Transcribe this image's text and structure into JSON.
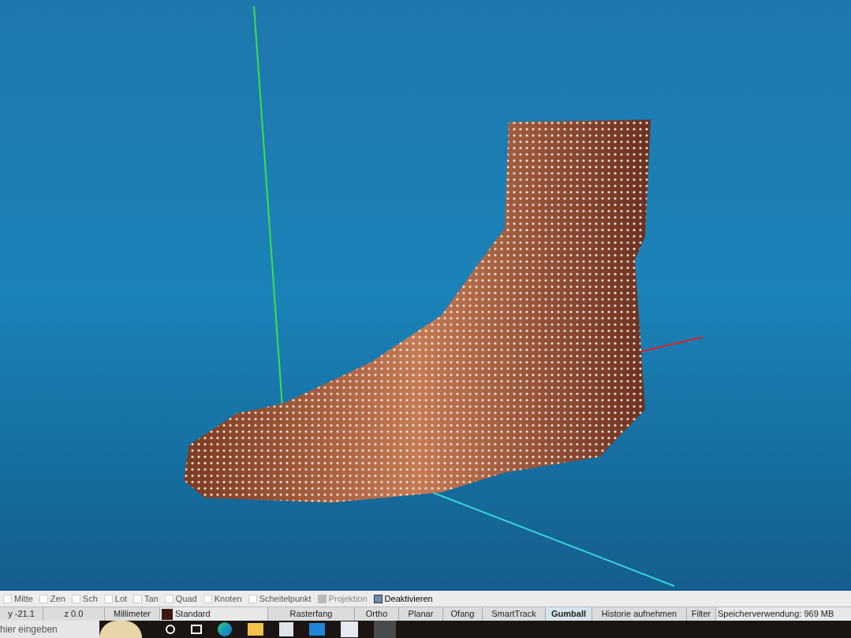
{
  "osnap": [
    {
      "label": "Mitte",
      "checked": false,
      "disabled": false
    },
    {
      "label": "Zen",
      "checked": false,
      "disabled": false
    },
    {
      "label": "Sch",
      "checked": false,
      "disabled": false
    },
    {
      "label": "Lot",
      "checked": false,
      "disabled": false
    },
    {
      "label": "Tan",
      "checked": false,
      "disabled": false
    },
    {
      "label": "Quad",
      "checked": false,
      "disabled": false
    },
    {
      "label": "Knoten",
      "checked": false,
      "disabled": false
    },
    {
      "label": "Scheitelpunkt",
      "checked": false,
      "disabled": false
    },
    {
      "label": "Projektion",
      "checked": false,
      "disabled": true
    },
    {
      "label": "Deaktivieren",
      "checked": true,
      "disabled": false
    }
  ],
  "status_bar": {
    "y": "y -21.1",
    "z": "z 0.0",
    "units": "Millimeter",
    "layer": {
      "name": "Standard",
      "color": "#3a1a10"
    },
    "toggles": [
      {
        "label": "Rasterfang",
        "on": false
      },
      {
        "label": "Ortho",
        "on": false
      },
      {
        "label": "Planar",
        "on": false
      },
      {
        "label": "Ofang",
        "on": false
      },
      {
        "label": "SmartTrack",
        "on": false
      },
      {
        "label": "Gumball",
        "on": true
      },
      {
        "label": "Historie aufnehmen",
        "on": false
      },
      {
        "label": "Filter",
        "on": false
      }
    ],
    "memory": "Speicherverwendung: 969 MB"
  },
  "taskbar": {
    "search": {
      "placeholder": "hier eingeben"
    }
  }
}
